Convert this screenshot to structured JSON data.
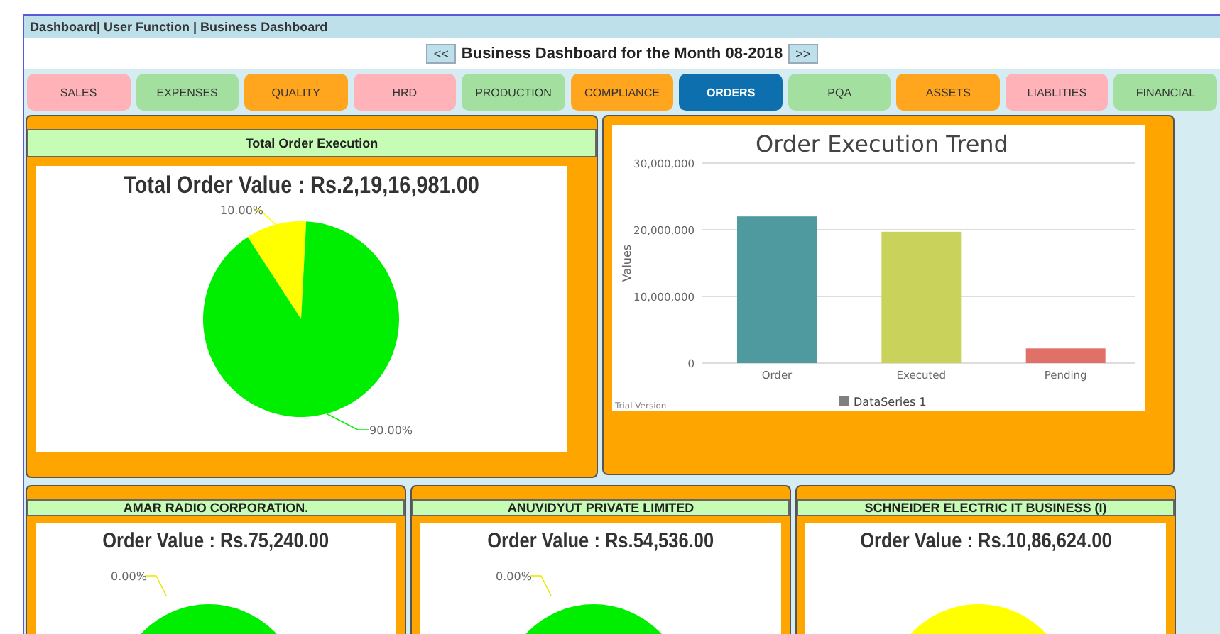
{
  "breadcrumb": "Dashboard| User Function | Business Dashboard",
  "month_nav": {
    "prev": "<<",
    "title": "Business Dashboard for the Month 08-2018",
    "next": ">>"
  },
  "tabs": [
    {
      "label": "SALES",
      "color": "#ffb3b8",
      "selected": false
    },
    {
      "label": "EXPENSES",
      "color": "#a3e0a0",
      "selected": false
    },
    {
      "label": "QUALITY",
      "color": "#ffa51e",
      "selected": false
    },
    {
      "label": "HRD",
      "color": "#ffb3b8",
      "selected": false
    },
    {
      "label": "PRODUCTION",
      "color": "#a3e0a0",
      "selected": false
    },
    {
      "label": "COMPLIANCE",
      "color": "#ffa51e",
      "selected": false
    },
    {
      "label": "ORDERS",
      "color": "#0e6fae",
      "selected": true
    },
    {
      "label": "PQA",
      "color": "#a3e0a0",
      "selected": false
    },
    {
      "label": "ASSETS",
      "color": "#ffa51e",
      "selected": false
    },
    {
      "label": "LIABLITIES",
      "color": "#ffb3b8",
      "selected": false
    },
    {
      "label": "FINANCIAL",
      "color": "#a3e0a0",
      "selected": false
    }
  ],
  "total_panel": {
    "header": "Total Order Execution",
    "value_title": "Total Order Value : Rs.2,19,16,981.00",
    "chart_data": {
      "type": "pie",
      "values": [
        10,
        90
      ],
      "value_labels": [
        "10.00%",
        "90.00%"
      ]
    }
  },
  "trend_panel": {
    "chart_data": {
      "type": "bar",
      "title": "Order Execution Trend",
      "ylabel": "Values",
      "categories": [
        "Order",
        "Executed",
        "Pending"
      ],
      "series": [
        {
          "name": "DataSeries 1",
          "values": [
            22000000,
            19700000,
            2200000
          ]
        }
      ],
      "ylim": [
        0,
        30000000
      ],
      "yticks": [
        {
          "value": 0,
          "label": "0"
        },
        {
          "value": 10000000,
          "label": "10,000,000"
        },
        {
          "value": 20000000,
          "label": "20,000,000"
        },
        {
          "value": 30000000,
          "label": "30,000,000"
        }
      ]
    },
    "watermark": "Trial Version"
  },
  "customers": [
    {
      "name": "AMAR RADIO CORPORATION.",
      "value_title": "Order Value  : Rs.75,240.00",
      "kind": "full",
      "slice_label": "0.00%"
    },
    {
      "name": "ANUVIDYUT PRIVATE LIMITED",
      "value_title": "Order Value  : Rs.54,536.00",
      "kind": "full",
      "slice_label": "0.00%"
    },
    {
      "name": "SCHNEIDER ELECTRIC IT BUSINESS (I)",
      "value_title": "Order Value  : Rs.10,86,624.00",
      "kind": "split"
    }
  ]
}
